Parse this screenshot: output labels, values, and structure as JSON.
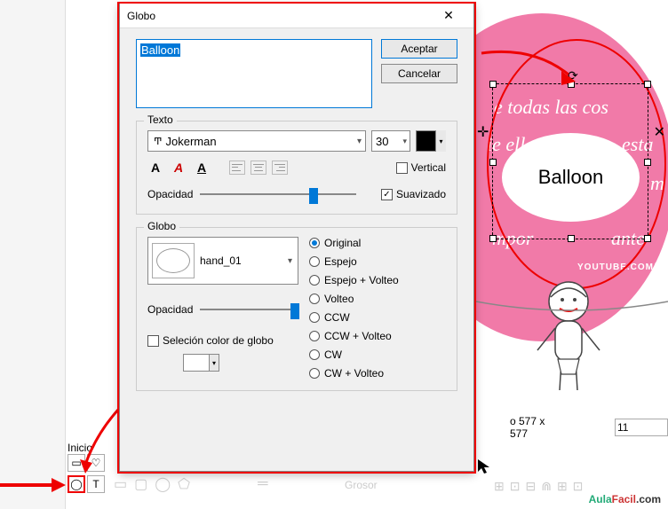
{
  "dialog": {
    "title": "Globo",
    "text_value": "Balloon",
    "accept": "Aceptar",
    "cancel": "Cancelar",
    "text_group": "Texto",
    "font_name": "Jokerman",
    "font_size": "30",
    "vertical_label": "Vertical",
    "vertical_checked": false,
    "smoothing_label": "Suavizado",
    "smoothing_checked": true,
    "opacity_label": "Opacidad",
    "globe_group": "Globo",
    "shape_name": "hand_01",
    "color_sel_label": "Seleción color de globo",
    "color_sel_checked": false,
    "orientations": [
      {
        "label": "Original",
        "checked": true
      },
      {
        "label": "Espejo",
        "checked": false
      },
      {
        "label": "Espejo + Volteo",
        "checked": false
      },
      {
        "label": "Volteo",
        "checked": false
      },
      {
        "label": "CCW",
        "checked": false
      },
      {
        "label": "CCW + Volteo",
        "checked": false
      },
      {
        "label": "CW",
        "checked": false
      },
      {
        "label": "CW + Volteo",
        "checked": false
      }
    ]
  },
  "canvas": {
    "balloon_text": "Balloon",
    "script1": "e todas las cos",
    "script2": "ie ella",
    "script3": "esta",
    "script4": "m",
    "script5": "mpor",
    "script6": "ante",
    "youtube": "YOUTUBE.COM/YUYA"
  },
  "bottom": {
    "inicio": "Inicio",
    "grosor": "Grosor",
    "dim_label": "o 577 x 577",
    "dim_val": "11",
    "aulafacil": "AulaFacil.com"
  }
}
